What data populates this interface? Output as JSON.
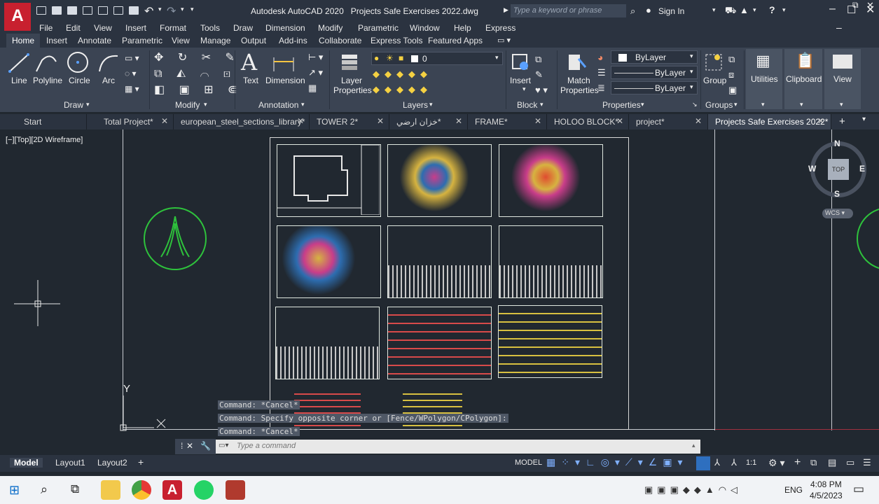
{
  "window": {
    "app_title": "Autodesk AutoCAD 2020",
    "document_title": "Projects Safe Exercises 2022.dwg",
    "search_placeholder": "Type a keyword or phrase",
    "sign_in": "Sign In"
  },
  "menu": [
    "File",
    "Edit",
    "View",
    "Insert",
    "Format",
    "Tools",
    "Draw",
    "Dimension",
    "Modify",
    "Parametric",
    "Window",
    "Help",
    "Express"
  ],
  "ribbon_tabs": [
    "Home",
    "Insert",
    "Annotate",
    "Parametric",
    "View",
    "Manage",
    "Output",
    "Add-ins",
    "Collaborate",
    "Express Tools",
    "Featured Apps"
  ],
  "ribbon": {
    "draw": {
      "line": "Line",
      "polyline": "Polyline",
      "circle": "Circle",
      "arc": "Arc",
      "label": "Draw"
    },
    "modify": {
      "label": "Modify"
    },
    "annotation": {
      "text": "Text",
      "dimension": "Dimension",
      "label": "Annotation"
    },
    "layers": {
      "layer_properties_1": "Layer",
      "layer_properties_2": "Properties",
      "current_layer": "0",
      "label": "Layers"
    },
    "block": {
      "insert": "Insert",
      "label": "Block"
    },
    "properties": {
      "match_1": "Match",
      "match_2": "Properties",
      "color": "ByLayer",
      "linetype": "ByLayer",
      "lineweight": "ByLayer",
      "label": "Properties"
    },
    "groups": {
      "group": "Group",
      "label": "Groups"
    },
    "utilities": "Utilities",
    "clipboard": "Clipboard",
    "view": "View"
  },
  "doc_tabs": [
    "Start",
    "Total Project*",
    "european_steel_sections_library*",
    "TOWER 2*",
    "خزان ارضي*",
    "FRAME*",
    "HOLOO BLOCK*",
    "project*",
    "Projects Safe Exercises 2022*"
  ],
  "viewport": {
    "label": "[−][Top][2D Wireframe]",
    "viewcube": {
      "n": "N",
      "s": "S",
      "e": "E",
      "w": "W",
      "top": "TOP",
      "wcs": "WCS"
    },
    "ucs_y": "Y"
  },
  "command_history": [
    "Command: *Cancel*",
    "Command: Specify opposite corner or [Fence/WPolygon/CPolygon]:",
    "Command: *Cancel*"
  ],
  "command_placeholder": "Type a command",
  "layout_tabs": [
    "Model",
    "Layout1",
    "Layout2"
  ],
  "status": {
    "model": "MODEL",
    "scale": "1:1"
  },
  "taskbar": {
    "lang": "ENG",
    "time": "4:08 PM",
    "date": "4/5/2023"
  },
  "colors": {
    "accent_red": "#c8202f",
    "background": "#212830",
    "ribbon": "#3b4453"
  }
}
